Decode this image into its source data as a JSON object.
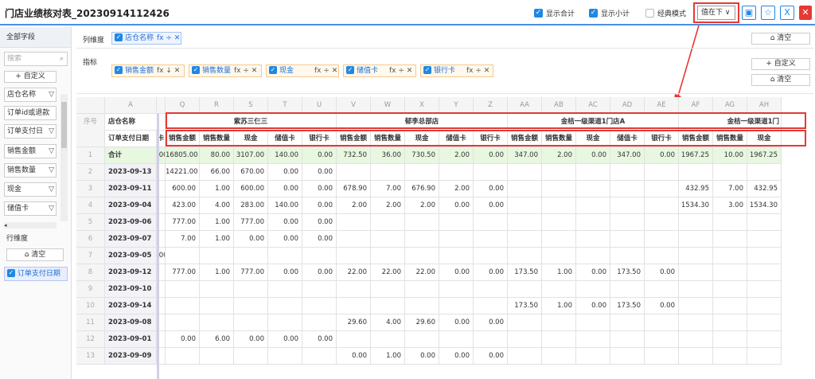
{
  "header": {
    "title": "门店业绩核对表_20230914112426",
    "show_total": "显示合计",
    "show_subtotal": "显示小计",
    "classic_mode": "经典模式",
    "value_position": "值在下"
  },
  "left": {
    "all_fields": "全部字段",
    "search_placeholder": "搜索",
    "add_custom": "+ 自定义",
    "fields": [
      "店仓名称",
      "订单id或退款",
      "订单支付日",
      "销售金额",
      "销售数量",
      "现金",
      "储值卡"
    ],
    "row_dim": "行维度",
    "clear": "清空",
    "row_chip": "订单支付日期"
  },
  "column_dim": {
    "label": "列维度",
    "chip": "店仓名称",
    "ops": "fx ÷ ✕"
  },
  "index": {
    "label": "指标",
    "chips": [
      {
        "name": "销售金额",
        "ops": "fx ↓ ✕"
      },
      {
        "name": "销售数量",
        "ops": "fx ÷ ✕"
      },
      {
        "name": "现金",
        "ops": "fx ÷ ✕"
      },
      {
        "name": "储值卡",
        "ops": "fx ÷ ✕"
      },
      {
        "name": "银行卡",
        "ops": "fx ÷ ✕"
      }
    ],
    "add_custom": "+ 自定义",
    "clear": "清空"
  },
  "grid": {
    "serial_hdr": "序号",
    "col_letters": [
      "A",
      "",
      "Q",
      "R",
      "S",
      "T",
      "U",
      "V",
      "W",
      "X",
      "Y",
      "Z",
      "AA",
      "AB",
      "AC",
      "AD",
      "AE",
      "AF",
      "AG",
      "AH"
    ],
    "store_label": "店仓名称",
    "stores": [
      "紫苏三仨三",
      "郁李总部店",
      "金桔一级渠道1门店A",
      "金桔一级渠道1门"
    ],
    "date_label": "订单支付日期",
    "hidden_hdr": "卡",
    "metrics": [
      "销售金额",
      "销售数量",
      "现金",
      "储值卡",
      "银行卡",
      "销售金额",
      "销售数量",
      "现金",
      "储值卡",
      "银行卡",
      "销售金额",
      "销售数量",
      "现金",
      "储值卡",
      "银行卡",
      "销售金额",
      "销售数量",
      "现金"
    ],
    "rows": [
      {
        "sn": "1",
        "label": "合计",
        "hid": ".00",
        "v": [
          "16805.00",
          "80.00",
          "3107.00",
          "140.00",
          "0.00",
          "732.50",
          "36.00",
          "730.50",
          "2.00",
          "0.00",
          "347.00",
          "2.00",
          "0.00",
          "347.00",
          "0.00",
          "1967.25",
          "10.00",
          "1967.25"
        ]
      },
      {
        "sn": "2",
        "label": "2023-09-13",
        "hid": "",
        "v": [
          "14221.00",
          "66.00",
          "670.00",
          "0.00",
          "0.00",
          "",
          "",
          "",
          "",
          "",
          "",
          "",
          "",
          "",
          "",
          "",
          "",
          ""
        ]
      },
      {
        "sn": "3",
        "label": "2023-09-11",
        "hid": "",
        "v": [
          "600.00",
          "1.00",
          "600.00",
          "0.00",
          "0.00",
          "678.90",
          "7.00",
          "676.90",
          "2.00",
          "0.00",
          "",
          "",
          "",
          "",
          "",
          "432.95",
          "7.00",
          "432.95"
        ]
      },
      {
        "sn": "4",
        "label": "2023-09-04",
        "hid": "",
        "v": [
          "423.00",
          "4.00",
          "283.00",
          "140.00",
          "0.00",
          "2.00",
          "2.00",
          "2.00",
          "0.00",
          "0.00",
          "",
          "",
          "",
          "",
          "",
          "1534.30",
          "3.00",
          "1534.30"
        ]
      },
      {
        "sn": "5",
        "label": "2023-09-06",
        "hid": "",
        "v": [
          "777.00",
          "1.00",
          "777.00",
          "0.00",
          "0.00",
          "",
          "",
          "",
          "",
          "",
          "",
          "",
          "",
          "",
          "",
          "",
          "",
          ""
        ]
      },
      {
        "sn": "6",
        "label": "2023-09-07",
        "hid": "",
        "v": [
          "7.00",
          "1.00",
          "0.00",
          "0.00",
          "0.00",
          "",
          "",
          "",
          "",
          "",
          "",
          "",
          "",
          "",
          "",
          "",
          "",
          ""
        ]
      },
      {
        "sn": "7",
        "label": "2023-09-05",
        "hid": ".00",
        "v": [
          "",
          "",
          "",
          "",
          "",
          "",
          "",
          "",
          "",
          "",
          "",
          "",
          "",
          "",
          "",
          "",
          "",
          ""
        ]
      },
      {
        "sn": "8",
        "label": "2023-09-12",
        "hid": "",
        "v": [
          "777.00",
          "1.00",
          "777.00",
          "0.00",
          "0.00",
          "22.00",
          "22.00",
          "22.00",
          "0.00",
          "0.00",
          "173.50",
          "1.00",
          "0.00",
          "173.50",
          "0.00",
          "",
          "",
          ""
        ]
      },
      {
        "sn": "9",
        "label": "2023-09-10",
        "hid": "",
        "v": [
          "",
          "",
          "",
          "",
          "",
          "",
          "",
          "",
          "",
          "",
          "",
          "",
          "",
          "",
          "",
          "",
          "",
          ""
        ]
      },
      {
        "sn": "10",
        "label": "2023-09-14",
        "hid": "",
        "v": [
          "",
          "",
          "",
          "",
          "",
          "",
          "",
          "",
          "",
          "",
          "173.50",
          "1.00",
          "0.00",
          "173.50",
          "0.00",
          "",
          "",
          ""
        ]
      },
      {
        "sn": "11",
        "label": "2023-09-08",
        "hid": "",
        "v": [
          "",
          "",
          "",
          "",
          "",
          "29.60",
          "4.00",
          "29.60",
          "0.00",
          "0.00",
          "",
          "",
          "",
          "",
          "",
          "",
          "",
          ""
        ]
      },
      {
        "sn": "12",
        "label": "2023-09-01",
        "hid": "",
        "v": [
          "0.00",
          "6.00",
          "0.00",
          "0.00",
          "0.00",
          "",
          "",
          "",
          "",
          "",
          "",
          "",
          "",
          "",
          "",
          "",
          "",
          ""
        ]
      },
      {
        "sn": "13",
        "label": "2023-09-09",
        "hid": "",
        "v": [
          "",
          "",
          "",
          "",
          "",
          "0.00",
          "1.00",
          "0.00",
          "0.00",
          "0.00",
          "",
          "",
          "",
          "",
          "",
          "",
          "",
          ""
        ]
      }
    ]
  },
  "colors": {
    "accent": "#1e88e5",
    "highlight": "#e53935",
    "total_row": "#e8f7e0"
  }
}
